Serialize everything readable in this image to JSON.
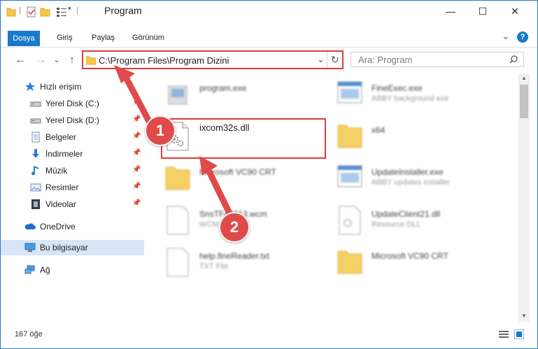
{
  "window": {
    "title": "Program",
    "controls": {
      "minimize": "—",
      "maximize": "☐",
      "close": "✕"
    }
  },
  "ribbon": {
    "tabs": [
      "Dosya",
      "Giriş",
      "Paylaş",
      "Görünüm"
    ],
    "help": "?",
    "expand": "⌄"
  },
  "navigation": {
    "back": "←",
    "forward": "→",
    "recent": "⌄",
    "up": "↑",
    "address": "C:\\Program Files\\Program Dizini",
    "search_placeholder": "Ara: Program"
  },
  "sidebar": {
    "items": [
      {
        "label": "Hızlı erişim",
        "icon": "star-icon",
        "pinned": false
      },
      {
        "label": "Yerel Disk (C:)",
        "icon": "drive-icon",
        "pinned": true
      },
      {
        "label": "Yerel Disk (D:)",
        "icon": "drive-icon",
        "pinned": true
      },
      {
        "label": "Belgeler",
        "icon": "documents-icon",
        "pinned": true
      },
      {
        "label": "İndirmeler",
        "icon": "download-icon",
        "pinned": true
      },
      {
        "label": "Müzik",
        "icon": "music-icon",
        "pinned": true
      },
      {
        "label": "Resimler",
        "icon": "pictures-icon",
        "pinned": true
      },
      {
        "label": "Videolar",
        "icon": "videos-icon",
        "pinned": true
      },
      {
        "label": "OneDrive",
        "icon": "cloud-icon",
        "pinned": false
      },
      {
        "label": "Bu bilgisayar",
        "icon": "computer-icon",
        "pinned": false,
        "selected": true
      },
      {
        "label": "Ağ",
        "icon": "network-icon",
        "pinned": false
      }
    ]
  },
  "files": [
    {
      "name": "program.exe",
      "desc": "",
      "icon": "exe-icon"
    },
    {
      "name": "FineExec.exe",
      "desc": "ABBY background exe",
      "icon": "window-icon"
    },
    {
      "name": "ixcom32s.dll",
      "desc": "",
      "icon": "dll-gear-icon"
    },
    {
      "name": "x64",
      "desc": "",
      "icon": "folder-icon"
    },
    {
      "name": "Microsoft VC90 CRT",
      "desc": "",
      "icon": "folder-icon"
    },
    {
      "name": "UpdateInstaller.exe",
      "desc": "ABBY updates installer",
      "icon": "window-icon"
    },
    {
      "name": "SnsTF4#913.wcm",
      "desc": "WCM File",
      "icon": "file-icon"
    },
    {
      "name": "UpdateClient21.dll",
      "desc": "Resource DLL",
      "icon": "dll-gear-icon"
    },
    {
      "name": "help.fineReader.txt",
      "desc": "TXT File",
      "icon": "file-icon"
    },
    {
      "name": "Microsoft VC90 CRT",
      "desc": "",
      "icon": "folder-icon"
    }
  ],
  "status": {
    "count": "167 öğe"
  },
  "annotations": {
    "step1": "1",
    "step2": "2"
  },
  "colors": {
    "accent": "#1979ca",
    "highlight": "#e03a3a",
    "selected": "#d7e6f7"
  }
}
